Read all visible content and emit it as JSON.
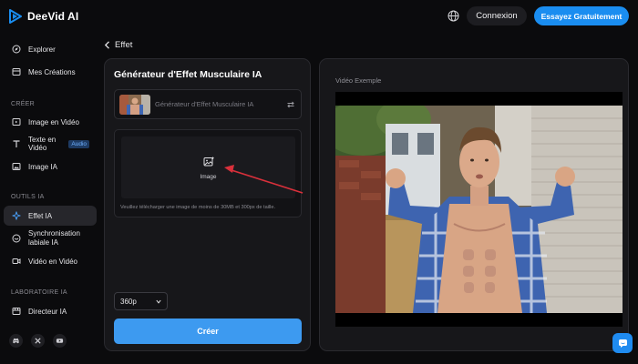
{
  "app": {
    "name": "DeeVid AI",
    "brand_color": "#1a8df0"
  },
  "sidebar": {
    "items": [
      {
        "label": "Explorer",
        "icon": "compass-icon"
      },
      {
        "label": "Mes Créations",
        "icon": "folder-icon"
      }
    ],
    "sections": [
      {
        "label": "CRÉER",
        "items": [
          {
            "label": "Image en Vidéo",
            "icon": "image-video-icon"
          },
          {
            "label": "Texte en Vidéo",
            "icon": "text-icon",
            "badge": "Audio"
          },
          {
            "label": "Image IA",
            "icon": "image-icon"
          }
        ]
      },
      {
        "label": "OUTILS IA",
        "items": [
          {
            "label": "Effet IA",
            "icon": "sparkle-icon",
            "active": true
          },
          {
            "label": "Synchronisation",
            "label2": "labiale IA",
            "icon": "lipsync-icon"
          },
          {
            "label": "Vidéo en Vidéo",
            "icon": "video-icon"
          }
        ]
      },
      {
        "label": "LABORATOIRE IA",
        "items": [
          {
            "label": "Directeur IA",
            "icon": "director-icon"
          }
        ]
      }
    ],
    "social": [
      "discord-icon",
      "x-icon",
      "youtube-icon"
    ]
  },
  "topbar": {
    "language_icon": "globe-icon",
    "login_label": "Connexion",
    "cta_label": "Essayez Gratuitement"
  },
  "breadcrumb": {
    "back_label": "Effet"
  },
  "generator": {
    "title": "Générateur d'Effet Musculaire IA",
    "effect_name": "Générateur d'Effet Musculaire IA",
    "upload_label": "Image",
    "upload_hint": "Veuillez télécharger une image de moins de 30MB et 300px de taille.",
    "resolution": "360p",
    "create_label": "Créer"
  },
  "preview": {
    "title": "Vidéo Exemple"
  },
  "chat": {
    "icon": "chat-icon"
  }
}
